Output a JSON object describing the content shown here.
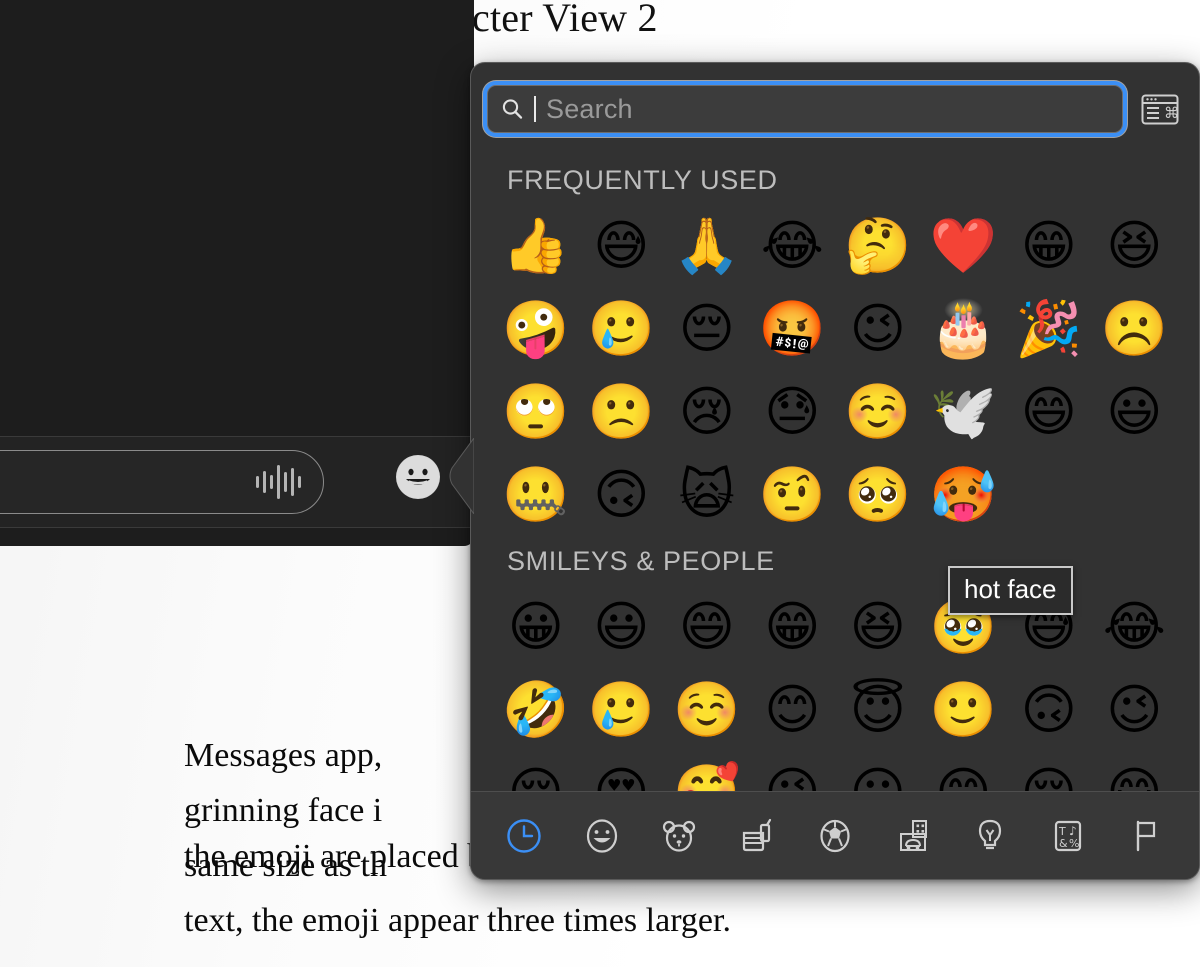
{
  "document": {
    "title": "cter View 2",
    "paragraph_lines": [
      "Messages app,",
      "grinning face i",
      "same size as th",
      "text, the emoji appear three times larger."
    ],
    "occluded_line": "the emoji are placed by themselves in"
  },
  "messages_window": {
    "compose_placeholder": "",
    "audio_icon": "waveform-icon",
    "emoji_button_icon": "grinning-face-icon"
  },
  "popover": {
    "search": {
      "placeholder": "Search",
      "value": "",
      "icon": "search-icon"
    },
    "character_viewer_button": {
      "icon": "character-viewer-icon",
      "label": ""
    },
    "sections": [
      {
        "title": "FREQUENTLY USED",
        "emojis": [
          "👍",
          "😅",
          "🙏",
          "😂",
          "🤔",
          "❤️",
          "😁",
          "😆",
          "🤪",
          "🥲",
          "😔",
          "🤬",
          "😉",
          "🎂",
          "🎉",
          "☹️",
          "🙄",
          "🙁",
          "😢",
          "😓",
          "☺️",
          "🕊️",
          "😄",
          "😃",
          "🤐",
          "🙃",
          "🙀",
          "🤨",
          "🥺",
          "🥵"
        ]
      },
      {
        "title": "SMILEYS & PEOPLE",
        "emojis": [
          "😀",
          "😃",
          "😄",
          "😁",
          "😆",
          "🥹",
          "😅",
          "😂",
          "🤣",
          "🥲",
          "☺️",
          "😊",
          "😇",
          "🙂",
          "🙃",
          "😉",
          "😌",
          "😍",
          "🥰",
          "😘",
          "😗",
          "😙",
          "😚",
          "😋"
        ]
      }
    ],
    "tooltip": {
      "text": "hot face",
      "for_emoji": "🥵"
    },
    "categories": [
      {
        "name": "frequently-used",
        "icon": "clock-icon",
        "selected": true
      },
      {
        "name": "smileys-people",
        "icon": "smiley-icon",
        "selected": false
      },
      {
        "name": "animals-nature",
        "icon": "bear-icon",
        "selected": false
      },
      {
        "name": "food-drink",
        "icon": "food-icon",
        "selected": false
      },
      {
        "name": "activity",
        "icon": "soccer-ball-icon",
        "selected": false
      },
      {
        "name": "travel-places",
        "icon": "city-car-icon",
        "selected": false
      },
      {
        "name": "objects",
        "icon": "lightbulb-icon",
        "selected": false
      },
      {
        "name": "symbols",
        "icon": "symbols-icon",
        "selected": false
      },
      {
        "name": "flags",
        "icon": "flag-icon",
        "selected": false
      }
    ]
  },
  "colors": {
    "accent": "#3b8ff5",
    "popover_bg": "#323232",
    "toolbar_bg": "#383838",
    "messages_bg": "#1d1d1d",
    "section_title": "#bdbdbd"
  }
}
